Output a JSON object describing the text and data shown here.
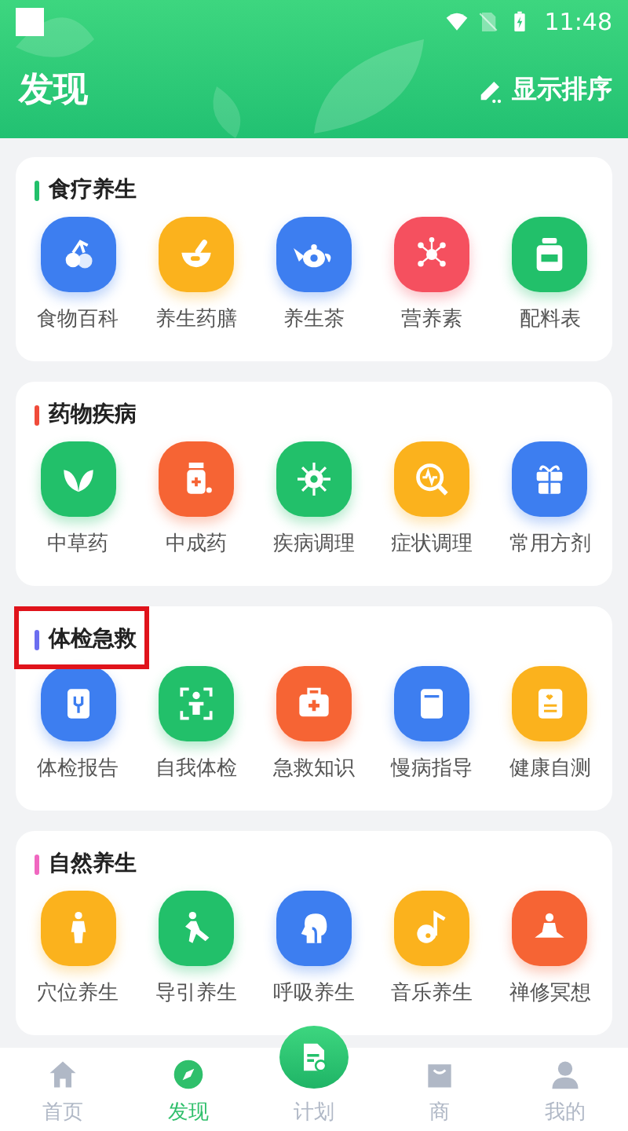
{
  "status_bar": {
    "time": "11:48"
  },
  "header": {
    "title": "发现",
    "sort_button": "显示排序"
  },
  "sections": [
    {
      "title": "食疗养生",
      "color": "#22c06a",
      "highlighted": false,
      "items": [
        {
          "label": "食物百科",
          "color": "#3d7ef0"
        },
        {
          "label": "养生药膳",
          "color": "#fbb21d"
        },
        {
          "label": "养生茶",
          "color": "#3d7ef0"
        },
        {
          "label": "营养素",
          "color": "#f5505f"
        },
        {
          "label": "配料表",
          "color": "#22c06a"
        }
      ]
    },
    {
      "title": "药物疾病",
      "color": "#f04b3a",
      "highlighted": false,
      "items": [
        {
          "label": "中草药",
          "color": "#22c06a"
        },
        {
          "label": "中成药",
          "color": "#f66434"
        },
        {
          "label": "疾病调理",
          "color": "#22c06a"
        },
        {
          "label": "症状调理",
          "color": "#fbb21d"
        },
        {
          "label": "常用方剂",
          "color": "#3d7ef0"
        }
      ]
    },
    {
      "title": "体检急救",
      "color": "#6b6ef0",
      "highlighted": true,
      "items": [
        {
          "label": "体检报告",
          "color": "#3d7ef0"
        },
        {
          "label": "自我体检",
          "color": "#22c06a"
        },
        {
          "label": "急救知识",
          "color": "#f66434"
        },
        {
          "label": "慢病指导",
          "color": "#3d7ef0"
        },
        {
          "label": "健康自测",
          "color": "#fbb21d"
        }
      ]
    },
    {
      "title": "自然养生",
      "color": "#f067c0",
      "highlighted": false,
      "items": [
        {
          "label": "穴位养生",
          "color": "#fbb21d"
        },
        {
          "label": "导引养生",
          "color": "#22c06a"
        },
        {
          "label": "呼吸养生",
          "color": "#3d7ef0"
        },
        {
          "label": "音乐养生",
          "color": "#fbb21d"
        },
        {
          "label": "禅修冥想",
          "color": "#f66434"
        }
      ]
    }
  ],
  "tab_bar": [
    {
      "label": "首页",
      "kind": "normal",
      "selected": false
    },
    {
      "label": "发现",
      "kind": "normal",
      "selected": true
    },
    {
      "label": "计划",
      "kind": "center",
      "selected": false
    },
    {
      "label": "商",
      "kind": "normal",
      "selected": false
    },
    {
      "label": "我的",
      "kind": "normal",
      "selected": false
    }
  ]
}
